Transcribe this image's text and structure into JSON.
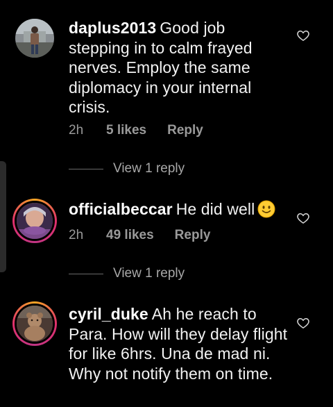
{
  "comments": [
    {
      "username": "daplus2013",
      "text": "Good job stepping in to calm frayed nerves. Employ the same diplomacy in your internal crisis.",
      "time": "2h",
      "likes": "5 likes",
      "reply_label": "Reply",
      "view_replies": "View 1 reply",
      "avatar_icon": "user-photo-standing"
    },
    {
      "username": "officialbeccar",
      "text": "He did well",
      "emoji": "slightly-smiling-face",
      "time": "2h",
      "likes": "49 likes",
      "reply_label": "Reply",
      "view_replies": "View 1 reply",
      "avatar_icon": "user-photo-selfie",
      "story_ring": true
    },
    {
      "username": "cyril_duke",
      "text": "Ah he reach to Para. How will they delay flight for like 6hrs. Una de mad ni. Why not notify them on time.",
      "avatar_icon": "user-photo-bear",
      "story_ring": true
    }
  ],
  "colors": {
    "background": "#000000",
    "text": "#f2f2f2",
    "muted": "#9a9a9a",
    "ring_start": "#f5a623",
    "ring_end": "#c13584"
  },
  "icons": {
    "like": "heart-outline-icon"
  }
}
